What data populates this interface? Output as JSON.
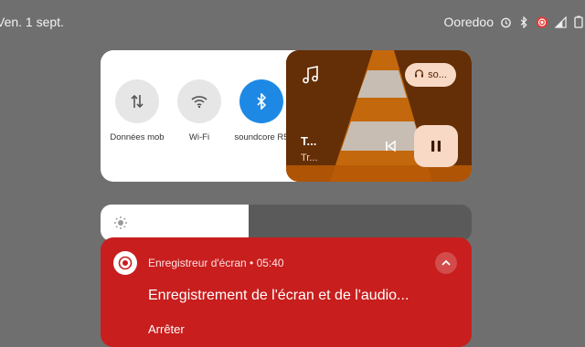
{
  "status_bar": {
    "date": "Ven. 1 sept.",
    "carrier": "Ooredoo",
    "icons": [
      "alarm-icon",
      "bluetooth-icon",
      "screen-record-icon",
      "signal-icon",
      "battery-icon"
    ]
  },
  "quick_settings": {
    "tiles": [
      {
        "label": "Données mob",
        "icon": "mobile-data-icon",
        "active": false
      },
      {
        "label": "Wi-Fi",
        "icon": "wifi-icon",
        "active": false
      },
      {
        "label": "soundcore R5",
        "icon": "bluetooth-icon",
        "active": true
      }
    ],
    "active_color": "#1e88e5"
  },
  "media": {
    "title": "T...",
    "artist": "Tr...",
    "output_label": "so...",
    "output_icon": "headphones-icon",
    "app_icon": "music-note-icon",
    "playing": true
  },
  "brightness": {
    "level": 0.4
  },
  "notification": {
    "app_name": "Enregistreur d'écran",
    "time": "05:40",
    "title": "Enregistrement de l'écran et de l'audio...",
    "action": "Arrêter",
    "color": "#c81e1e"
  }
}
